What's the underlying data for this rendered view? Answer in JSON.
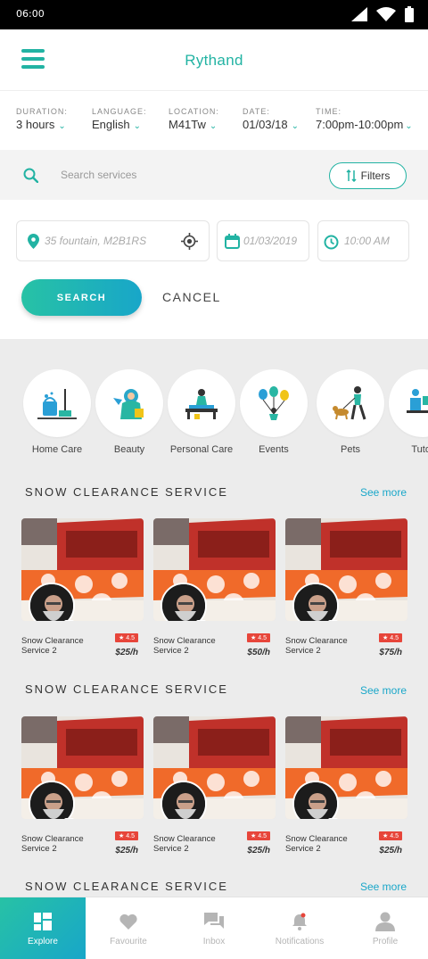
{
  "status": {
    "time": "06:00"
  },
  "app": {
    "title": "Rythand"
  },
  "filters": [
    {
      "label": "DURATION:",
      "value": "3 hours"
    },
    {
      "label": "LANGUAGE:",
      "value": "English"
    },
    {
      "label": "LOCATION:",
      "value": "M41Tw"
    },
    {
      "label": "DATE:",
      "value": "01/03/18"
    },
    {
      "label": "TIME:",
      "value": "7:00pm-10:00pm"
    }
  ],
  "search": {
    "placeholder": "Search services",
    "filters_label": "Filters"
  },
  "inputs": {
    "location": "35 fountain, M2B1RS",
    "date": "01/03/2019",
    "time": "10:00 AM"
  },
  "actions": {
    "search_label": "SEARCH",
    "cancel_label": "CANCEL"
  },
  "categories": [
    {
      "name": "Home Care",
      "icon": "home-care-icon"
    },
    {
      "name": "Beauty",
      "icon": "beauty-icon"
    },
    {
      "name": "Personal Care",
      "icon": "personal-care-icon"
    },
    {
      "name": "Events",
      "icon": "events-icon"
    },
    {
      "name": "Pets",
      "icon": "pets-icon"
    },
    {
      "name": "Tutor",
      "icon": "tutor-icon"
    }
  ],
  "sections": [
    {
      "title": "SNOW CLEARANCE SERVICE",
      "see_more": "See more",
      "cards": [
        {
          "name_line1": "Snow Clearance",
          "name_line2": "Service 2",
          "rating": "4.5",
          "price": "$25/h"
        },
        {
          "name_line1": "Snow Clearance",
          "name_line2": "Service 2",
          "rating": "4.5",
          "price": "$50/h"
        },
        {
          "name_line1": "Snow Clearance",
          "name_line2": "Service 2",
          "rating": "4.5",
          "price": "$75/h"
        }
      ]
    },
    {
      "title": "SNOW CLEARANCE SERVICE",
      "see_more": "See more",
      "cards": [
        {
          "name_line1": "Snow Clearance",
          "name_line2": "Service 2",
          "rating": "4.5",
          "price": "$25/h"
        },
        {
          "name_line1": "Snow Clearance",
          "name_line2": "Service 2",
          "rating": "4.5",
          "price": "$25/h"
        },
        {
          "name_line1": "Snow Clearance",
          "name_line2": "Service 2",
          "rating": "4.5",
          "price": "$25/h"
        }
      ]
    },
    {
      "title": "SNOW CLEARANCE SERVICE",
      "see_more": "See more"
    }
  ],
  "nav": [
    {
      "label": "Explore",
      "icon": "explore-icon",
      "active": true
    },
    {
      "label": "Favourite",
      "icon": "heart-icon",
      "active": false
    },
    {
      "label": "Inbox",
      "icon": "inbox-icon",
      "active": false
    },
    {
      "label": "Notifications",
      "icon": "bell-icon",
      "active": false
    },
    {
      "label": "Profile",
      "icon": "profile-icon",
      "active": false
    }
  ],
  "colors": {
    "accent": "#22b3a3",
    "gradient_start": "#27c2a5",
    "gradient_end": "#18a6c9",
    "link": "#1aa7c9",
    "rating": "#e7453a"
  }
}
